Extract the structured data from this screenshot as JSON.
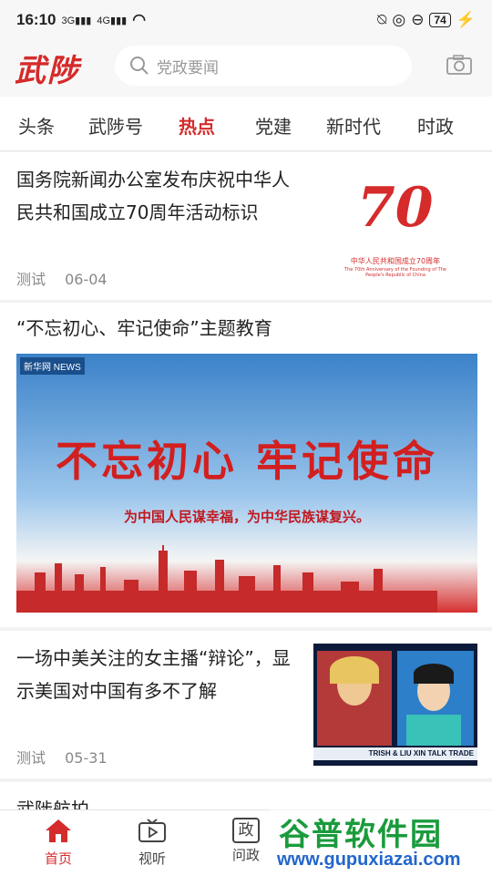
{
  "status": {
    "time": "16:10",
    "sig1": "3G",
    "sig2": "4G",
    "battery": "74"
  },
  "header": {
    "logo": "武陟",
    "search_placeholder": "党政要闻"
  },
  "tabs": [
    {
      "label": "头条"
    },
    {
      "label": "武陟号"
    },
    {
      "label": "热点"
    },
    {
      "label": "党建"
    },
    {
      "label": "新时代"
    },
    {
      "label": "时政"
    }
  ],
  "news": [
    {
      "title": "国务院新闻办公室发布庆祝中华人民共和国成立70周年活动标识",
      "source": "测试",
      "date": "06-04",
      "thumb": {
        "num": "70",
        "caption_cn": "中华人民共和国成立70周年",
        "caption_en": "The 70th Anniversary of the Founding of The People's Republic of China"
      }
    },
    {
      "title": "“不忘初心、牢记使命”主题教育",
      "banner": {
        "slogan": "不忘初心 牢记使命",
        "subtitle": "为中国人民谋幸福，为中华民族谋复兴。",
        "corner": "新华网 NEWS"
      }
    },
    {
      "title": "一场中美关注的女主播“辩论”，显示美国对中国有多不了解",
      "source": "测试",
      "date": "05-31",
      "thumb": {
        "ticker": "TRISH & LIU XIN TALK TRADE"
      }
    },
    {
      "title": "武陟航拍"
    }
  ],
  "bottom_nav": [
    {
      "label": "首页",
      "icon": "home-icon"
    },
    {
      "label": "视听",
      "icon": "tv-icon"
    },
    {
      "label": "问政",
      "icon": "politics-icon",
      "glyph": "政"
    }
  ],
  "watermark": {
    "main": "谷普软件园",
    "url": "www.gupuxiazai.com"
  },
  "colors": {
    "accent": "#d52b2b"
  }
}
